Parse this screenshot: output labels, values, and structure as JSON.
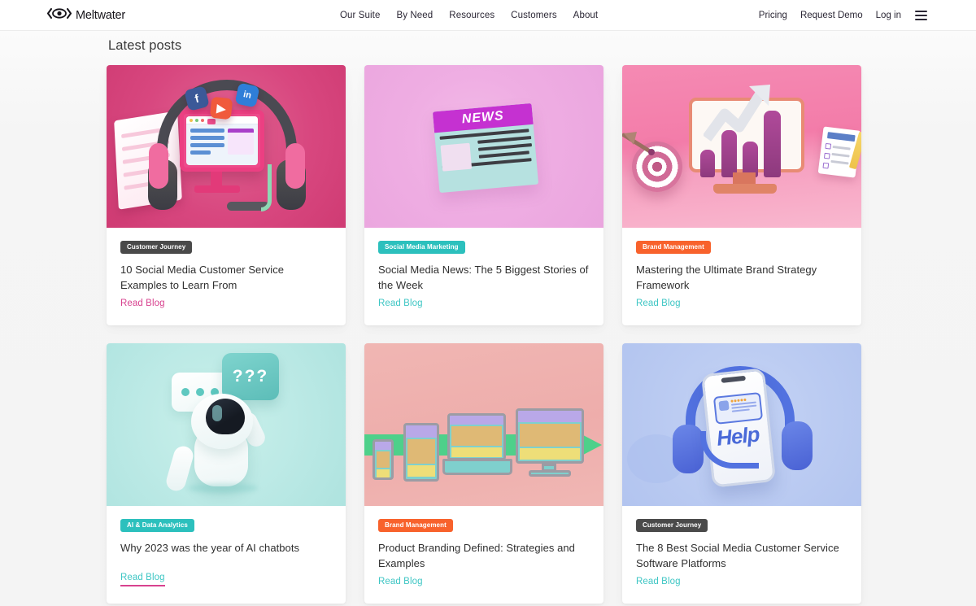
{
  "header": {
    "brand": "Meltwater",
    "brand_icon": "meltwater-eye-logo",
    "nav": [
      {
        "label": "Our Suite"
      },
      {
        "label": "By Need"
      },
      {
        "label": "Resources"
      },
      {
        "label": "Customers"
      },
      {
        "label": "About"
      }
    ],
    "utility": [
      {
        "label": "Pricing"
      },
      {
        "label": "Request Demo"
      },
      {
        "label": "Log in"
      }
    ],
    "menu_icon": "hamburger-menu-icon"
  },
  "section": {
    "title": "Latest posts"
  },
  "colors": {
    "badge_customer_journey": "#4a4a4a",
    "badge_social_media_marketing": "#2cc0bd",
    "badge_brand_management": "#f8622c",
    "badge_ai_data_analytics": "#2cc0bd",
    "link_pink": "#d8428f",
    "link_teal": "#3ec6c4",
    "page_background": "#f4f4f4",
    "card_background": "#ffffff",
    "title_text": "#2f2f2f"
  },
  "cards": [
    {
      "badge": "Customer Journey",
      "badge_color": "#4a4a4a",
      "title": "10 Social Media Customer Service Examples to Learn From",
      "cta": "Read Blog",
      "cta_color": "#d8428f",
      "cta_hovered": false,
      "image_alt": "3d-illustration-pink-monitor-with-headset-and-social-media-icons",
      "image_bg": "#d8477f"
    },
    {
      "badge": "Social Media Marketing",
      "badge_color": "#2cc0bd",
      "title": "Social Media News: The 5 Biggest Stories of the Week",
      "cta": "Read Blog",
      "cta_color": "#3ec6c4",
      "cta_hovered": false,
      "image_alt": "3d-illustration-newspaper-with-news-masthead",
      "image_bg": "#efaee3",
      "image_text": "NEWS"
    },
    {
      "badge": "Brand Management",
      "badge_color": "#f8622c",
      "title": "Mastering the Ultimate Brand Strategy Framework",
      "cta": "Read Blog",
      "cta_color": "#3ec6c4",
      "cta_hovered": false,
      "image_alt": "3d-illustration-dartboard-bar-chart-growth-arrow-checklist",
      "image_bg": "#f37ca9"
    },
    {
      "badge": "AI & Data Analytics",
      "badge_color": "#2cc0bd",
      "title": "Why 2023 was the year of AI chatbots",
      "cta": "Read Blog",
      "cta_color": "#3ec6c4",
      "cta_hovered": true,
      "image_alt": "3d-illustration-white-robot-with-question-mark-speech-bubbles",
      "image_bg": "#bdeae6",
      "image_text": "???"
    },
    {
      "badge": "Brand Management",
      "badge_color": "#f8622c",
      "title": "Product Branding Defined: Strategies and Examples",
      "cta": "Read Blog",
      "cta_color": "#3ec6c4",
      "cta_hovered": false,
      "image_alt": "3d-illustration-responsive-devices-phone-tablet-laptop-monitor-green-arrow",
      "image_bg": "#eeadab"
    },
    {
      "badge": "Customer Journey",
      "badge_color": "#4a4a4a",
      "title": "The 8 Best Social Media Customer Service Software Platforms",
      "cta": "Read Blog",
      "cta_color": "#3ec6c4",
      "cta_hovered": false,
      "image_alt": "3d-illustration-smartphone-with-help-text-and-blue-headphones",
      "image_bg": "#bcccf2",
      "image_text": "Help"
    }
  ]
}
